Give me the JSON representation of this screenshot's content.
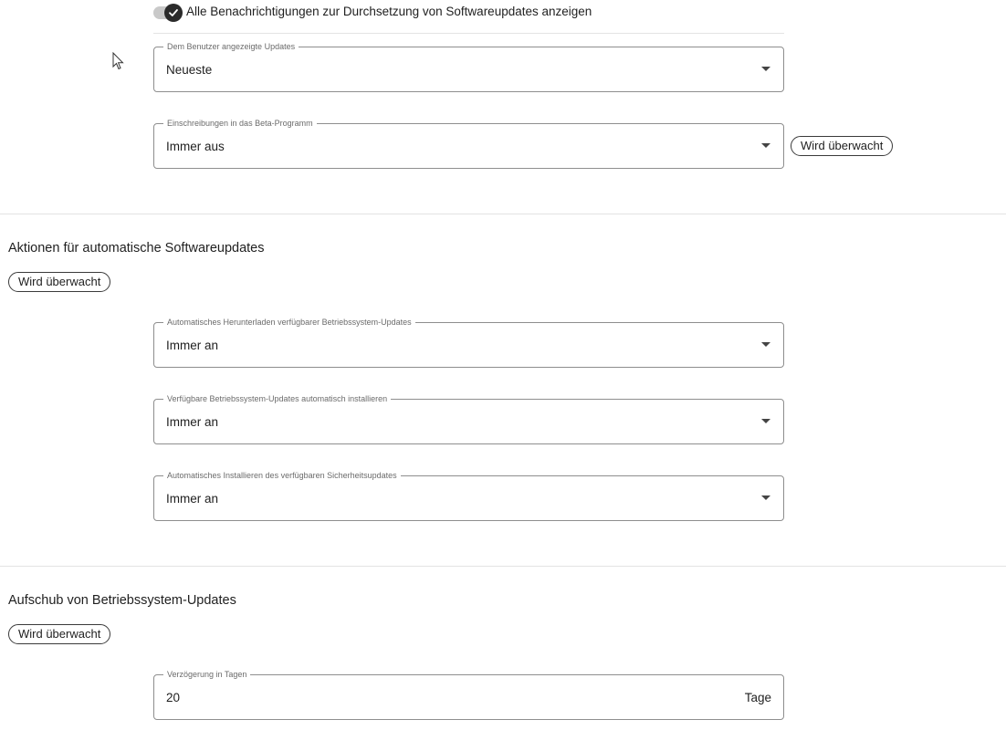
{
  "toggle": {
    "label": "Alle Benachrichtigungen zur Durchsetzung von Softwareupdates anzeigen",
    "checked": true
  },
  "updates_shown": {
    "label": "Dem Benutzer angezeigte Updates",
    "value": "Neueste"
  },
  "beta": {
    "label": "Einschreibungen in das Beta-Programm",
    "value": "Immer aus",
    "chip": "Wird überwacht"
  },
  "auto_actions": {
    "title": "Aktionen für automatische Softwareupdates",
    "chip": "Wird überwacht",
    "fields": [
      {
        "label": "Automatisches Herunterladen verfügbarer Betriebssystem-Updates",
        "value": "Immer an"
      },
      {
        "label": "Verfügbare Betriebssystem-Updates automatisch installieren",
        "value": "Immer an"
      },
      {
        "label": "Automatisches Installieren des verfügbaren Sicherheitsupdates",
        "value": "Immer an"
      }
    ]
  },
  "deferral": {
    "title": "Aufschub von Betriebssystem-Updates",
    "chip": "Wird überwacht",
    "delay": {
      "label": "Verzögerung in Tagen",
      "value": "20",
      "suffix": "Tage"
    }
  },
  "icons": {
    "toggle_check": "check-icon",
    "dropdown": "caret-down-icon",
    "pointer": "mouse-pointer-icon"
  },
  "colors": {
    "toggle_knob": "#2b2b2b",
    "toggle_track": "#c9c9c9",
    "outline": "#8e8e8e"
  }
}
